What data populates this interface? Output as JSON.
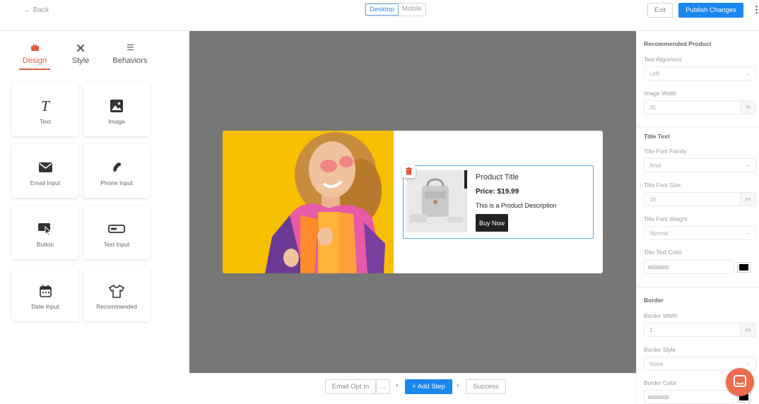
{
  "header": {
    "back_label": "← Back",
    "device_desktop": "Desktop",
    "device_mobile": "Mobile",
    "exit_label": "Exit",
    "publish_label": "Publish Changes",
    "more_label": "⋮"
  },
  "left_panel": {
    "tabs": [
      {
        "label": "Design",
        "icon": "design-icon"
      },
      {
        "label": "Style",
        "icon": "style-icon"
      },
      {
        "label": "Behaviors",
        "icon": "behaviors-icon"
      }
    ],
    "elements": [
      {
        "label": "Text",
        "icon": "text-icon"
      },
      {
        "label": "Image",
        "icon": "image-icon"
      },
      {
        "label": "Email Input",
        "icon": "email-icon"
      },
      {
        "label": "Phone Input",
        "icon": "phone-icon"
      },
      {
        "label": "Button",
        "icon": "button-icon"
      },
      {
        "label": "Text Input",
        "icon": "text-input-icon"
      },
      {
        "label": "Date Input",
        "icon": "date-icon"
      },
      {
        "label": "Recommended",
        "icon": "shirt-icon"
      }
    ]
  },
  "preview": {
    "product_title": "Product Title",
    "price": "Price: $19.99",
    "description": "This is a Product Description",
    "buy_label": "Buy Now"
  },
  "steps": {
    "step1": "Email Opt In",
    "ellipsis": "...",
    "add_step": "+ Add Step",
    "success": "Success"
  },
  "right_panel": {
    "section_product": "Recommended Product",
    "text_alignment_label": "Text Alignment",
    "text_alignment_value": "Left",
    "image_width_label": "Image Width",
    "image_width_value": "35",
    "image_width_unit": "%",
    "section_title_text": "Title Text",
    "title_font_family_label": "Title Font Family",
    "title_font_family_value": "Arial",
    "title_font_size_label": "Title Font Size",
    "title_font_size_value": "16",
    "title_font_size_unit": "px",
    "title_font_weight_label": "Title Font Weight",
    "title_font_weight_value": "Normal",
    "title_text_color_label": "Title Text Color",
    "title_text_color_value": "#000000",
    "section_border": "Border",
    "border_width_label": "Border Width",
    "border_width_value": "1",
    "border_width_unit": "px",
    "border_style_label": "Border Style",
    "border_style_value": "None",
    "border_color_label": "Border Color",
    "border_color_value": "#000000"
  },
  "colors": {
    "accent_blue": "#1a87ee",
    "accent_orange": "#e05b3b",
    "canvas_gray": "#777777",
    "hero_yellow": "#f6c000",
    "chat_orange": "#ed6b4f"
  }
}
